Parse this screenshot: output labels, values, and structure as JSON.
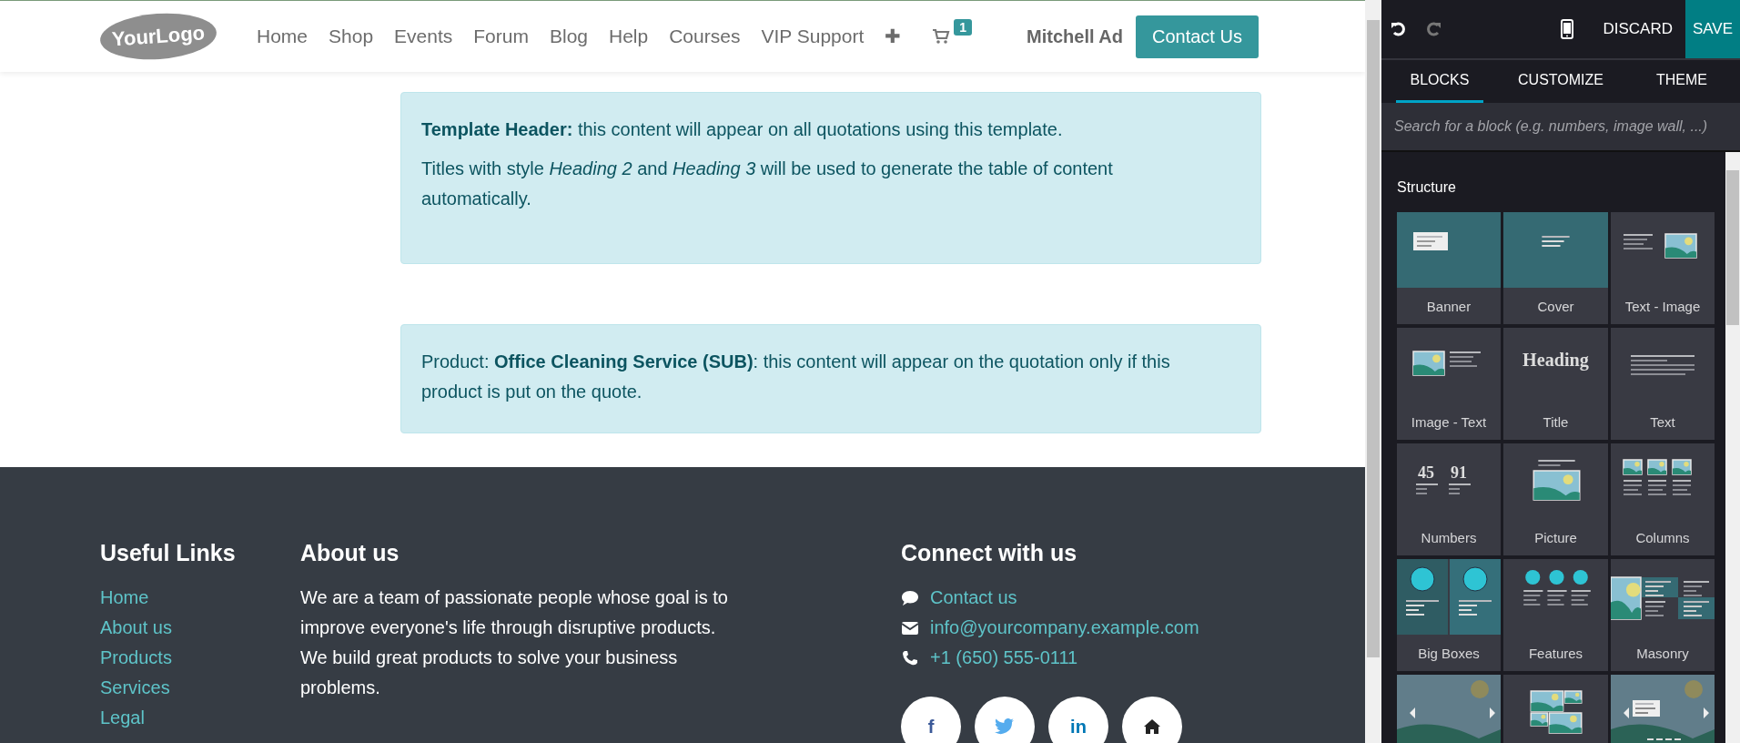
{
  "header": {
    "logo": {
      "text": "YourLogo"
    },
    "nav": [
      {
        "label": "Home"
      },
      {
        "label": "Shop"
      },
      {
        "label": "Events"
      },
      {
        "label": "Forum"
      },
      {
        "label": "Blog"
      },
      {
        "label": "Help"
      },
      {
        "label": "Courses"
      },
      {
        "label": "VIP Support"
      },
      {
        "label": "✚"
      }
    ],
    "cart_count": "1",
    "user": "Mitchell Ad",
    "cta": "Contact Us"
  },
  "notes": [
    {
      "paragraphs": [
        "**Template Header:** this content will appear on all quotations using this template.",
        "Titles with style *Heading 2* and *Heading 3* will be used to generate the table of content automatically."
      ]
    },
    {
      "paragraphs": [
        "Product: **Office Cleaning Service (SUB)**: this content will appear on the quotation only if this product is put on the quote."
      ]
    }
  ],
  "footer": {
    "links_title": "Useful Links",
    "links": [
      "Home",
      "About us",
      "Products",
      "Services",
      "Legal"
    ],
    "about_title": "About us",
    "about_text": "We are a team of passionate people whose goal is to improve everyone's life through disruptive products. We build great products to solve your business problems.",
    "connect_title": "Connect with us",
    "contacts": [
      {
        "kind": "chat",
        "text": "Contact us"
      },
      {
        "kind": "mail",
        "text": "info@yourcompany.example.com"
      },
      {
        "kind": "phone",
        "text": "+1 (650) 555-0111"
      }
    ],
    "social": [
      {
        "kind": "facebook",
        "text": "f"
      },
      {
        "kind": "twitter"
      },
      {
        "kind": "linkedin",
        "text": "in"
      },
      {
        "kind": "home"
      }
    ]
  },
  "editor": {
    "discard": "DISCARD",
    "save": "SAVE",
    "redo_disabled": true,
    "tabs": [
      {
        "label": "BLOCKS",
        "selected": true
      },
      {
        "label": "CUSTOMIZE",
        "selected": false
      },
      {
        "label": "THEME",
        "selected": false
      }
    ],
    "search": {
      "placeholder": "Search for a block (e.g. numbers, image wall, ...)"
    },
    "section": "Structure",
    "blocks": [
      {
        "kind": "banner",
        "label": "Banner"
      },
      {
        "kind": "cover",
        "label": "Cover"
      },
      {
        "kind": "text-image",
        "label": "Text - Image"
      },
      {
        "kind": "image-text",
        "label": "Image - Text"
      },
      {
        "kind": "title",
        "label": "Title",
        "thumb_text": "Heading"
      },
      {
        "kind": "text",
        "label": "Text"
      },
      {
        "kind": "numbers",
        "label": "Numbers",
        "numbers": [
          "45",
          "91"
        ]
      },
      {
        "kind": "picture",
        "label": "Picture"
      },
      {
        "kind": "columns",
        "label": "Columns"
      },
      {
        "kind": "big-boxes",
        "label": "Big Boxes"
      },
      {
        "kind": "features",
        "label": "Features"
      },
      {
        "kind": "masonry",
        "label": "Masonry"
      },
      {
        "kind": "carousel"
      },
      {
        "kind": "gallery"
      },
      {
        "kind": "slider"
      }
    ]
  }
}
